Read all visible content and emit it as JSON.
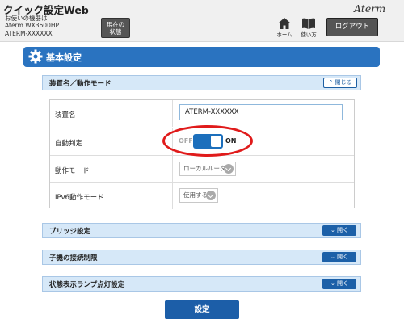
{
  "header": {
    "app_title": "クイック設定Web",
    "device_lines": [
      "お使いの機器は",
      "Aterm WX3600HP",
      "ATERM-XXXXXX"
    ],
    "status_button": [
      "現在の",
      "状態"
    ],
    "brand": "Aterm",
    "nav": {
      "home_label": "ホーム",
      "manual_label": "使い方"
    },
    "logout_label": "ログアウト"
  },
  "section": {
    "title": "基本設定",
    "icon": "gear-icon"
  },
  "panels": {
    "device_mode": {
      "title": "装置名／動作モード",
      "toggle_label": "閉じる"
    },
    "bridge": {
      "title": "ブリッジ設定",
      "toggle_label": "開く"
    },
    "child_limit": {
      "title": "子機の接続制限",
      "toggle_label": "開く"
    },
    "lamp": {
      "title": "状態表示ランプ点灯設定",
      "toggle_label": "開く"
    }
  },
  "settings": {
    "device_name": {
      "label": "装置名",
      "value": "ATERM-XXXXXX"
    },
    "auto_detect": {
      "label": "自動判定",
      "off_label": "OFF",
      "on_label": "ON",
      "state": "on"
    },
    "operation_mode": {
      "label": "動作モード",
      "value": "ローカルルータ"
    },
    "ipv6_mode": {
      "label": "IPv6動作モード",
      "value": "使用する"
    }
  },
  "submit_label": "設定",
  "colors": {
    "accent": "#2a73c0",
    "highlight": "#e01b1b"
  }
}
